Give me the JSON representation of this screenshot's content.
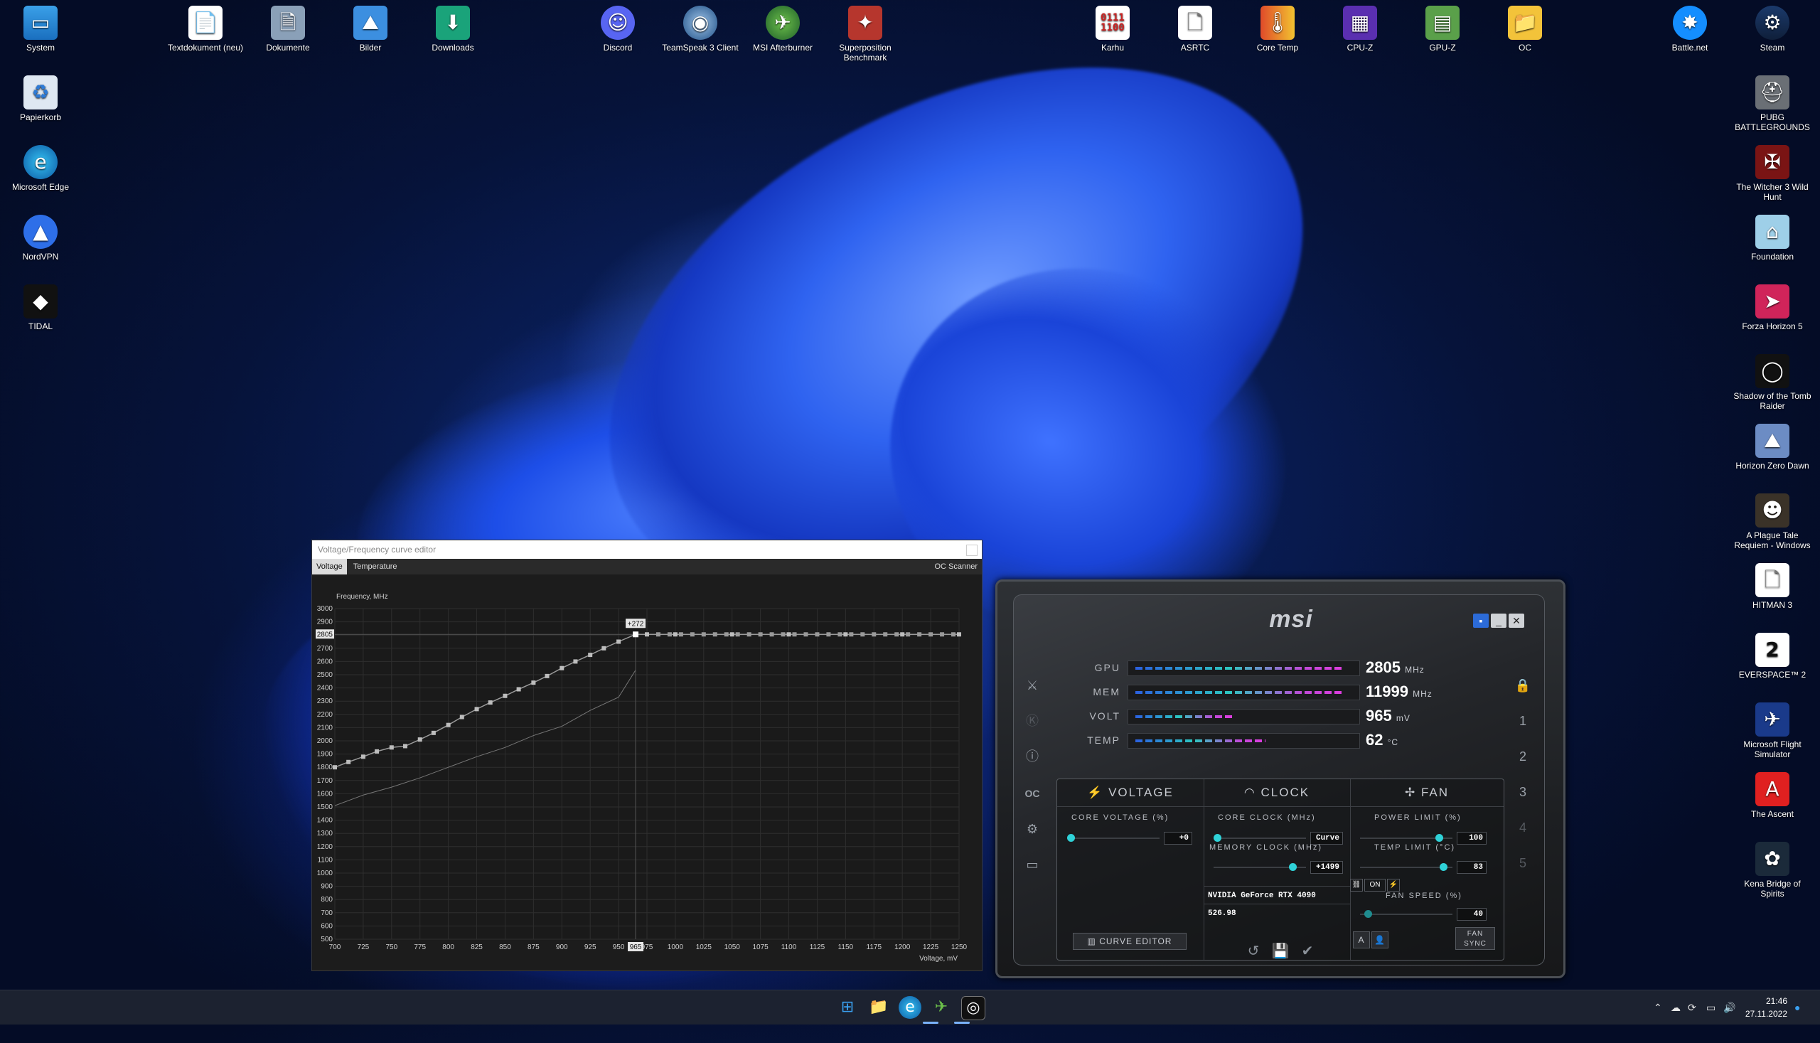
{
  "desktop_left": [
    {
      "label": "System",
      "icon": "monitor-icon"
    },
    {
      "label": "Papierkorb",
      "icon": "recycle-bin-icon"
    },
    {
      "label": "Microsoft Edge",
      "icon": "edge-icon"
    },
    {
      "label": "NordVPN",
      "icon": "nordvpn-icon"
    },
    {
      "label": "TIDAL",
      "icon": "tidal-icon"
    }
  ],
  "desktop_top": [
    {
      "label": "Textdokument (neu)",
      "icon": "text-document-icon"
    },
    {
      "label": "Dokumente",
      "icon": "documents-folder-icon"
    },
    {
      "label": "Bilder",
      "icon": "pictures-folder-icon"
    },
    {
      "label": "Downloads",
      "icon": "downloads-folder-icon"
    },
    {
      "label": "Discord",
      "icon": "discord-icon"
    },
    {
      "label": "TeamSpeak 3 Client",
      "icon": "teamspeak-icon"
    },
    {
      "label": "MSI Afterburner",
      "icon": "afterburner-icon"
    },
    {
      "label": "Superposition Benchmark",
      "icon": "superposition-icon"
    },
    {
      "label": "Karhu",
      "icon": "karhu-icon"
    },
    {
      "label": "ASRTC",
      "icon": "asrtc-file-icon"
    },
    {
      "label": "Core Temp",
      "icon": "core-temp-icon"
    },
    {
      "label": "CPU-Z",
      "icon": "cpu-z-icon"
    },
    {
      "label": "GPU-Z",
      "icon": "gpu-z-icon"
    },
    {
      "label": "OC",
      "icon": "folder-icon"
    },
    {
      "label": "Battle.net",
      "icon": "battlenet-icon"
    },
    {
      "label": "Steam",
      "icon": "steam-icon"
    }
  ],
  "desktop_right": [
    {
      "label": "PUBG BATTLEGROUNDS",
      "icon": "pubg-icon"
    },
    {
      "label": "The Witcher 3 Wild Hunt",
      "icon": "witcher-icon"
    },
    {
      "label": "Foundation",
      "icon": "foundation-icon"
    },
    {
      "label": "Forza Horizon 5",
      "icon": "forza-icon"
    },
    {
      "label": "Shadow of the Tomb Raider",
      "icon": "tomb-raider-icon"
    },
    {
      "label": "Horizon Zero Dawn",
      "icon": "horizon-icon"
    },
    {
      "label": "A Plague Tale Requiem - Windows",
      "icon": "plague-tale-icon"
    },
    {
      "label": "HITMAN 3",
      "icon": "hitman-file-icon"
    },
    {
      "label": "EVERSPACE™ 2",
      "icon": "everspace-icon"
    },
    {
      "label": "Microsoft Flight Simulator",
      "icon": "flight-sim-icon"
    },
    {
      "label": "The Ascent",
      "icon": "ascent-icon"
    },
    {
      "label": "Kena Bridge of Spirits",
      "icon": "kena-icon"
    }
  ],
  "vf_editor": {
    "title": "Voltage/Frequency curve editor",
    "tabs": [
      "Voltage",
      "Temperature"
    ],
    "oc_scanner": "OC Scanner",
    "selected_point_label": "+272",
    "selected_x_label": "965",
    "selected_y_label": "2805"
  },
  "chart_data": {
    "type": "line",
    "xlabel": "Voltage, mV",
    "ylabel": "Frequency, MHz",
    "xlim": [
      700,
      1250
    ],
    "ylim": [
      500,
      3000
    ],
    "x_ticks": [
      700,
      725,
      750,
      775,
      800,
      825,
      850,
      875,
      900,
      925,
      950,
      975,
      1000,
      1025,
      1050,
      1075,
      1100,
      1125,
      1150,
      1175,
      1200,
      1225,
      1250
    ],
    "y_ticks": [
      500,
      600,
      700,
      800,
      900,
      1000,
      1100,
      1200,
      1300,
      1400,
      1500,
      1600,
      1700,
      1800,
      1900,
      2000,
      2100,
      2200,
      2300,
      2400,
      2500,
      2600,
      2700,
      2800,
      2900,
      3000
    ],
    "grid": true,
    "series": [
      {
        "style": "curve",
        "x": [
          700,
          712,
          725,
          737,
          750,
          762,
          775,
          787,
          800,
          812,
          825,
          837,
          850,
          862,
          875,
          887,
          900,
          912,
          925,
          937,
          950,
          965,
          975,
          1000,
          1050,
          1100,
          1150,
          1200,
          1250
        ],
        "y": [
          1800,
          1840,
          1880,
          1920,
          1950,
          1960,
          2010,
          2060,
          2120,
          2180,
          2240,
          2290,
          2340,
          2390,
          2440,
          2490,
          2550,
          2600,
          2650,
          2700,
          2750,
          2805,
          2805,
          2805,
          2805,
          2805,
          2805,
          2805,
          2805
        ]
      },
      {
        "style": "reference",
        "x": [
          700,
          725,
          750,
          775,
          800,
          825,
          850,
          875,
          900,
          925,
          950,
          965
        ],
        "y": [
          1510,
          1590,
          1650,
          1720,
          1800,
          1880,
          1950,
          2040,
          2110,
          2230,
          2330,
          2535
        ]
      }
    ]
  },
  "afterburner": {
    "logo": "msi",
    "monitors": [
      {
        "label": "GPU",
        "value": "2805",
        "unit": "MHz"
      },
      {
        "label": "MEM",
        "value": "11999",
        "unit": "MHz"
      },
      {
        "label": "VOLT",
        "value": "965",
        "unit": "mV"
      },
      {
        "label": "TEMP",
        "value": "62",
        "unit": "°C"
      }
    ],
    "monitor_levels": [
      0.96,
      0.96,
      0.45,
      0.6
    ],
    "sections": {
      "voltage": "VOLTAGE",
      "clock": "CLOCK",
      "fan": "FAN"
    },
    "core_voltage_label": "CORE VOLTAGE (%)",
    "core_voltage_value": "+0",
    "core_clock_label": "CORE CLOCK (MHz)",
    "core_clock_value": "Curve",
    "memory_clock_label": "MEMORY CLOCK (MHz)",
    "memory_clock_value": "+1499",
    "power_limit_label": "POWER LIMIT (%)",
    "power_limit_value": "100",
    "temp_limit_label": "TEMP LIMIT (°C)",
    "temp_limit_value": "83",
    "link_on": "ON",
    "fan_speed_label": "FAN SPEED (%)",
    "fan_speed_value": "40",
    "gpu_name": "NVIDIA GeForce RTX 4090",
    "driver": "526.98",
    "curve_editor": "CURVE EDITOR",
    "fan_sync": "FAN SYNC",
    "profiles": [
      "1",
      "2",
      "3",
      "4",
      "5"
    ]
  },
  "taskbar": {
    "time": "21:46",
    "date": "27.11.2022"
  }
}
